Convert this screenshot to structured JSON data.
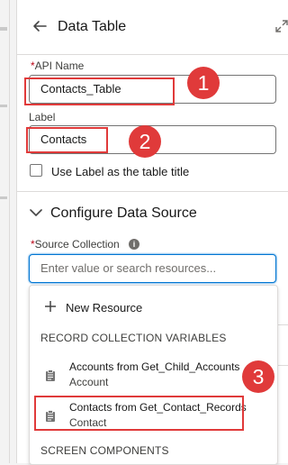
{
  "panel": {
    "title": "Data Table"
  },
  "fields": {
    "api_name": {
      "required_mark": "*",
      "label": "API Name",
      "value": "Contacts_Table"
    },
    "label": {
      "label": "Label",
      "value": "Contacts"
    },
    "use_label_checkbox": {
      "label": "Use Label as the table title",
      "checked": false
    }
  },
  "section": {
    "title": "Configure Data Source"
  },
  "source_collection": {
    "required_mark": "*",
    "label": "Source Collection",
    "placeholder": "Enter value or search resources..."
  },
  "dropdown": {
    "new_resource_label": "New Resource",
    "heading_record_collection": "RECORD COLLECTION VARIABLES",
    "items": [
      {
        "title": "Accounts from Get_Child_Accounts",
        "subtitle": "Account"
      },
      {
        "title": "Contacts from Get_Contact_Records",
        "subtitle": "Contact"
      }
    ],
    "heading_screen_components": "SCREEN COMPONENTS"
  },
  "callouts": [
    "1",
    "2",
    "3"
  ],
  "colors": {
    "callout": "#e03a3a",
    "focus": "#0176d3",
    "required": "#ba0517"
  },
  "icons": {
    "back": "arrow-left-icon",
    "expand": "expand-icon",
    "section": "chevron-down-icon",
    "info": "info-icon",
    "add": "plus-icon",
    "record": "clipboard-icon"
  }
}
